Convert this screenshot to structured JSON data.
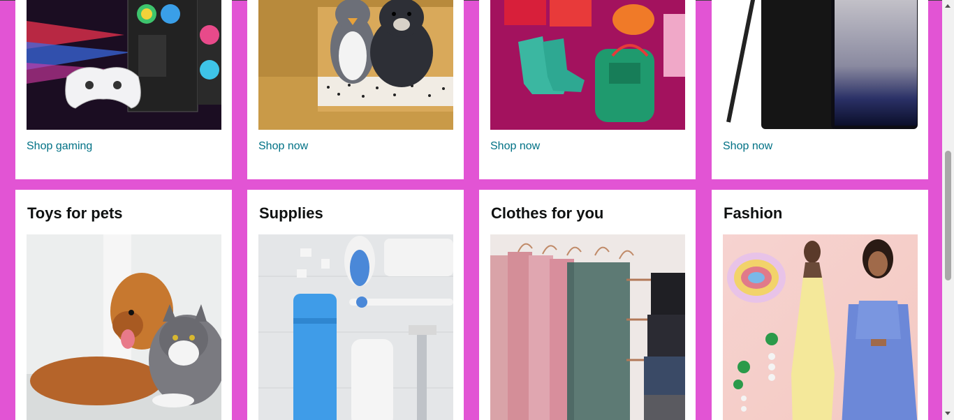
{
  "colors": {
    "page_background": "#e254d4",
    "card_background": "#ffffff",
    "link": "#007185",
    "title": "#0f1111"
  },
  "top_row": [
    {
      "image_icon": "gaming-pc-controller-image",
      "link": "Shop gaming"
    },
    {
      "image_icon": "plush-toys-image",
      "link": "Shop now"
    },
    {
      "image_icon": "gifts-boots-backpack-image",
      "link": "Shop now"
    },
    {
      "image_icon": "smartphone-stylus-image",
      "link": "Shop now"
    }
  ],
  "bottom_row": [
    {
      "title": "Toys for pets",
      "image_icon": "dog-and-cat-image"
    },
    {
      "title": "Supplies",
      "image_icon": "toiletries-supplies-image"
    },
    {
      "title": "Clothes for you",
      "image_icon": "hanging-clothes-image"
    },
    {
      "title": "Fashion",
      "image_icon": "fashion-models-image"
    }
  ]
}
